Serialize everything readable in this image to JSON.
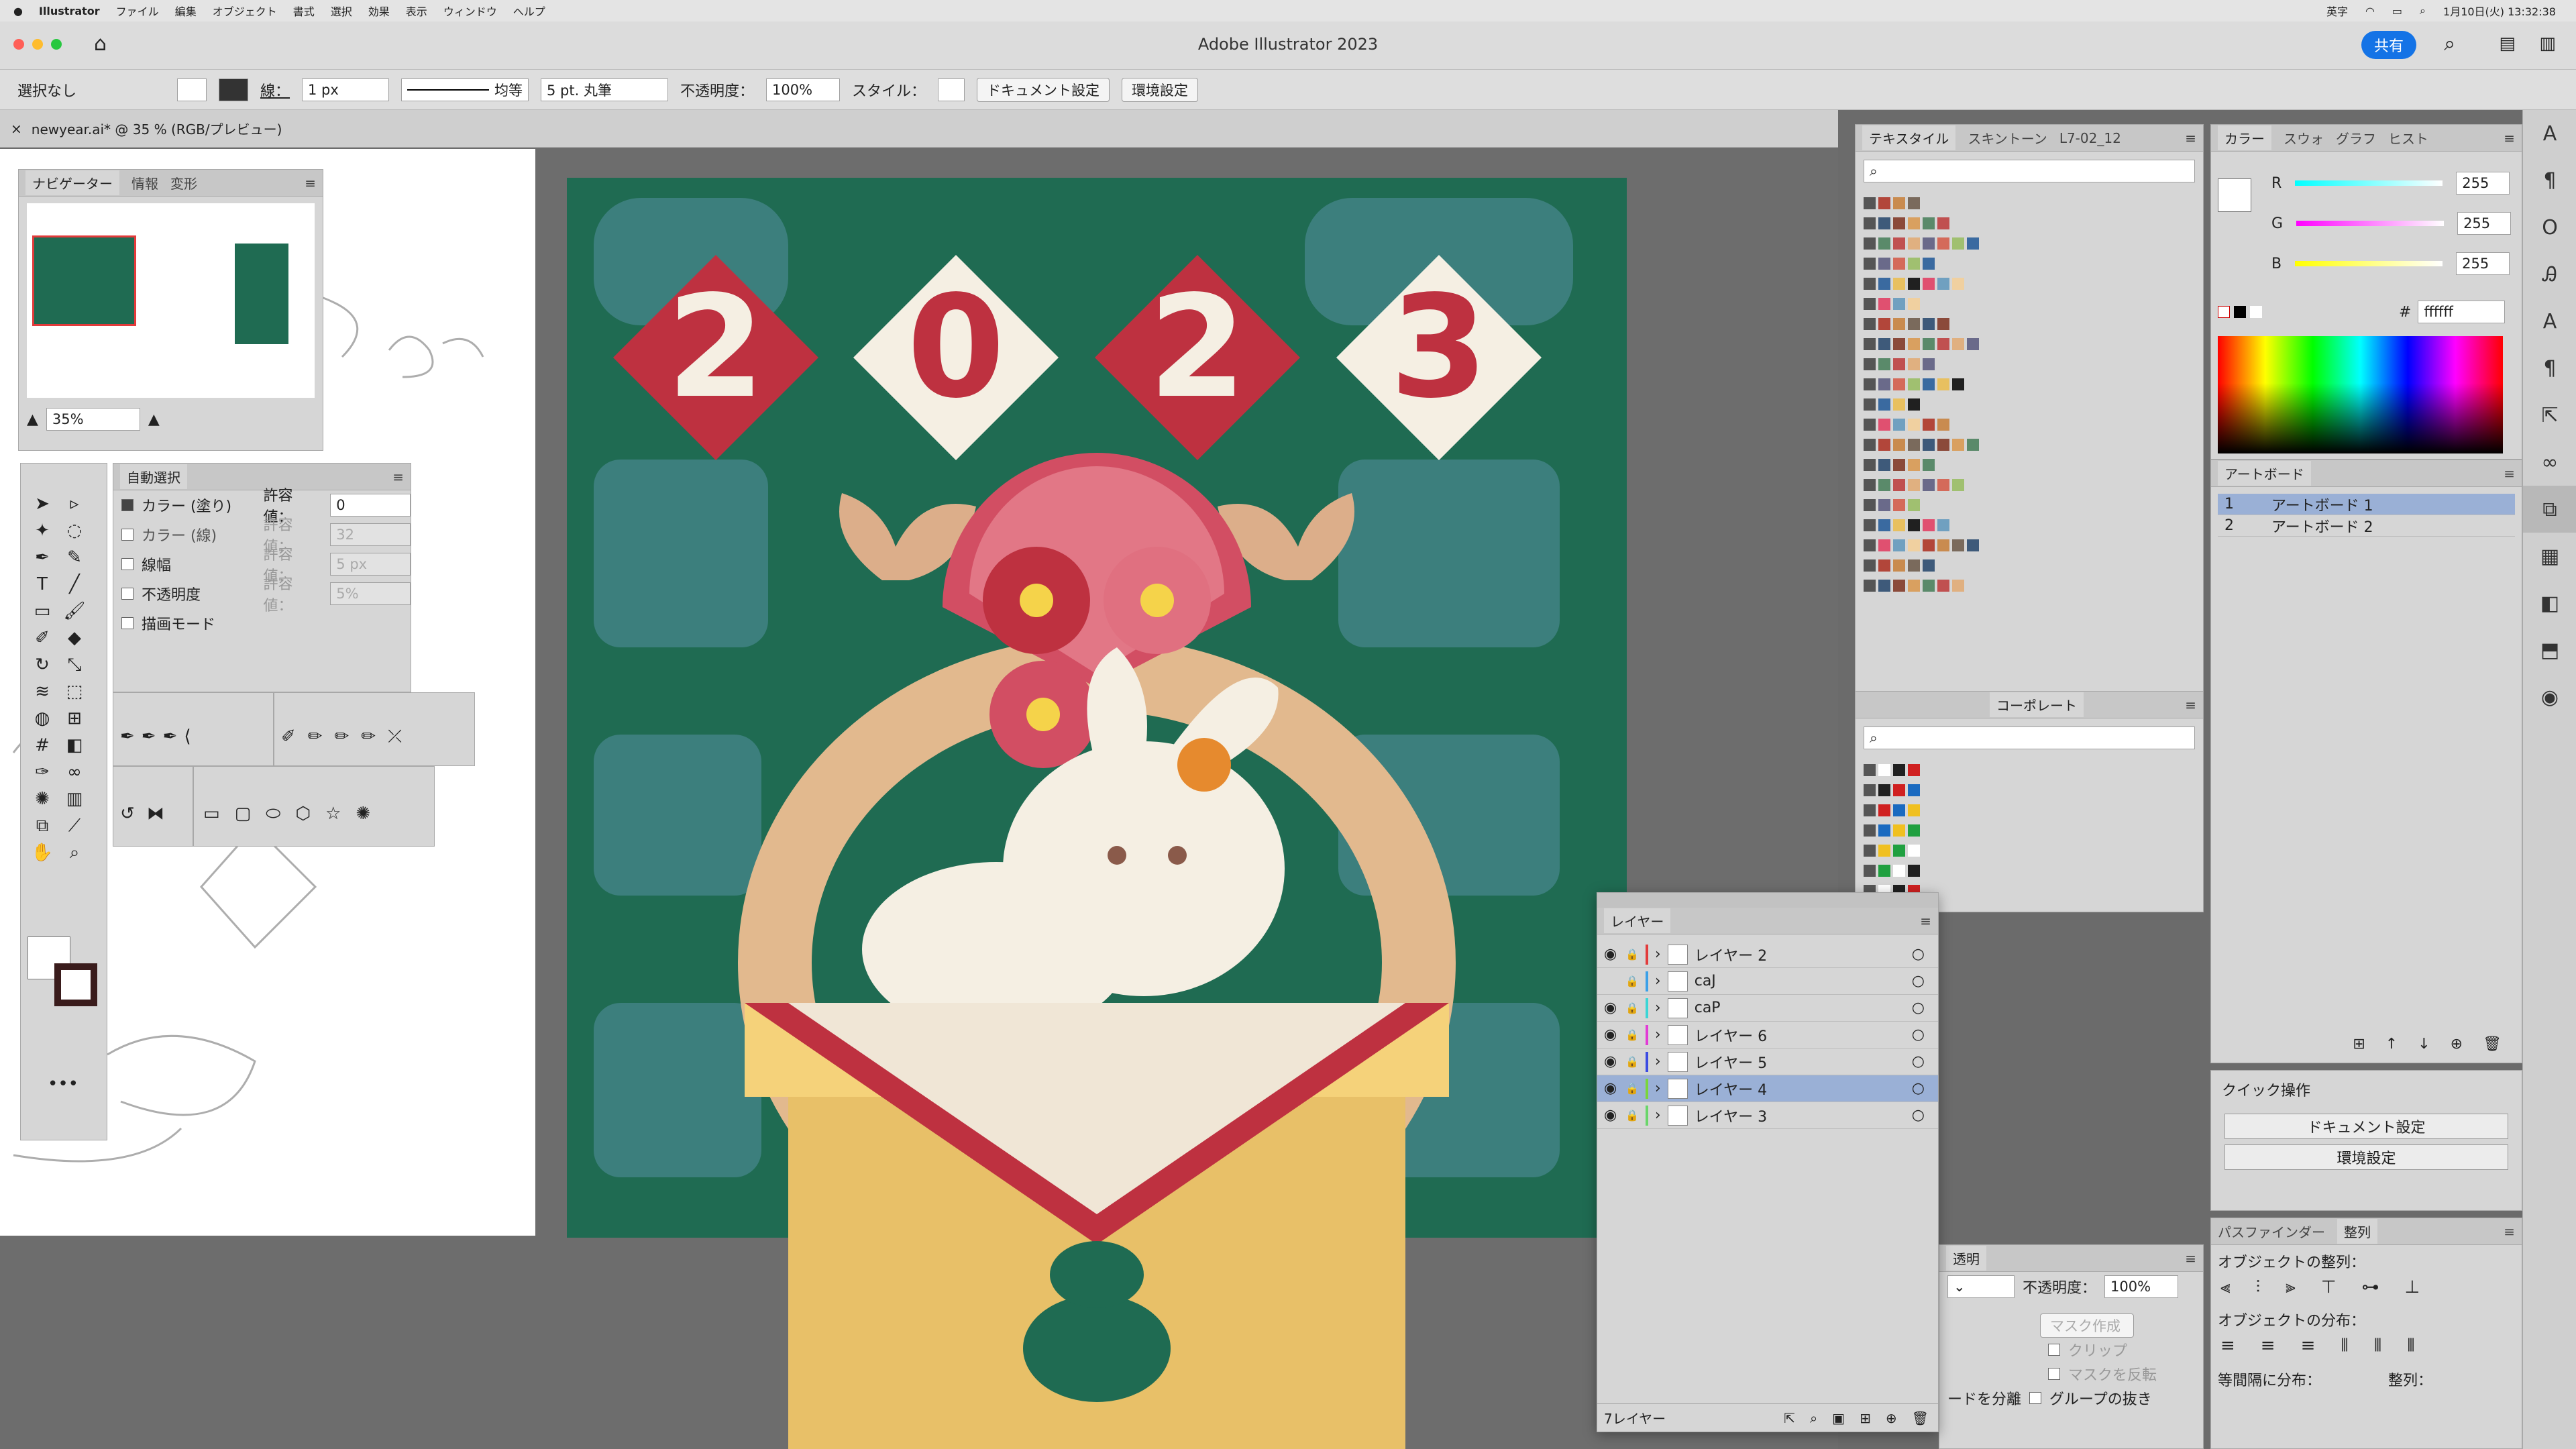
{
  "menubar": {
    "app": "Illustrator",
    "items": [
      "ファイル",
      "編集",
      "オブジェクト",
      "書式",
      "選択",
      "効果",
      "表示",
      "ウィンドウ",
      "ヘルプ"
    ],
    "date_time": "1月10日(火) 13:32:38",
    "input": "英字"
  },
  "window": {
    "title": "Adobe Illustrator 2023",
    "share": "共有"
  },
  "control": {
    "selection": "選択なし",
    "stroke_label": "線：",
    "stroke_width": "1 px",
    "profile": "均等",
    "brush": "5 pt. 丸筆",
    "opacity_label": "不透明度：",
    "opacity": "100%",
    "style_label": "スタイル：",
    "doc_settings": "ドキュメント設定",
    "prefs": "環境設定"
  },
  "doc_tab": {
    "label": "newyear.ai* @ 35 % (RGB/プレビュー)"
  },
  "navigator": {
    "tabs": [
      "ナビゲーター",
      "情報",
      "変形"
    ],
    "zoom": "35%"
  },
  "magic_wand": {
    "title": "自動選択",
    "rows": [
      {
        "label": "カラー (塗り)",
        "tol_label": "許容値：",
        "value": "0",
        "checked": true
      },
      {
        "label": "カラー (線)",
        "tol_label": "許容値：",
        "value": "32",
        "checked": false
      },
      {
        "label": "線幅",
        "tol_label": "許容値：",
        "value": "5 px",
        "checked": false
      },
      {
        "label": "不透明度",
        "tol_label": "許容値：",
        "value": "5%",
        "checked": false
      },
      {
        "label": "描画モード",
        "tol_label": "",
        "value": "",
        "checked": false
      }
    ]
  },
  "artwork": {
    "year": [
      "2",
      "0",
      "2",
      "3"
    ],
    "colors": {
      "bg": "#1f6b52",
      "red": "#be3140",
      "cream": "#f5efe3",
      "gold": "#e8c068",
      "rope": "#e2b98e"
    }
  },
  "swatch_panel": {
    "tabs": [
      "テキスタイル",
      "スキントーン",
      "L7-02_12"
    ]
  },
  "library_panel": {
    "tabs": [
      "コーポレート"
    ]
  },
  "color_panel": {
    "tabs": [
      "カラー",
      "スウォ",
      "グラフ",
      "ヒスト"
    ],
    "r_label": "R",
    "g_label": "G",
    "b_label": "B",
    "r": "255",
    "g": "255",
    "b": "255",
    "hex_label": "#",
    "hex": "ffffff"
  },
  "artboard_panel": {
    "title": "アートボード",
    "items": [
      {
        "num": "1",
        "name": "アートボード 1"
      },
      {
        "num": "2",
        "name": "アートボード 2"
      }
    ]
  },
  "quick_actions": {
    "title": "クイック操作",
    "doc_settings": "ドキュメント設定",
    "prefs": "環境設定"
  },
  "pathfinder": {
    "tabs": [
      "パスファインダー",
      "整列"
    ],
    "align_objects": "オブジェクトの整列：",
    "distribute_objects": "オブジェクトの分布：",
    "distribute_spacing": "等間隔に分布：",
    "align_to": "整列："
  },
  "layers_panel": {
    "title": "レイヤー",
    "layers": [
      "レイヤー 2",
      "caJ",
      "caP",
      "レイヤー 6",
      "レイヤー 5",
      "レイヤー 4",
      "レイヤー 3"
    ],
    "layer_colors": [
      "#e23b3b",
      "#3aa0e8",
      "#3ad6d6",
      "#e23bd6",
      "#3b4be2",
      "#7ad63b",
      "#6ad66a"
    ],
    "count": "7レイヤー"
  },
  "transparency_panel": {
    "tab": "透明",
    "opacity_label": "不透明度：",
    "opacity": "100%",
    "mask_btn": "マスク作成",
    "clip": "クリップ",
    "invert": "マスクを反転",
    "isolate": "グループの抜き",
    "knockout": "ードを分離"
  }
}
